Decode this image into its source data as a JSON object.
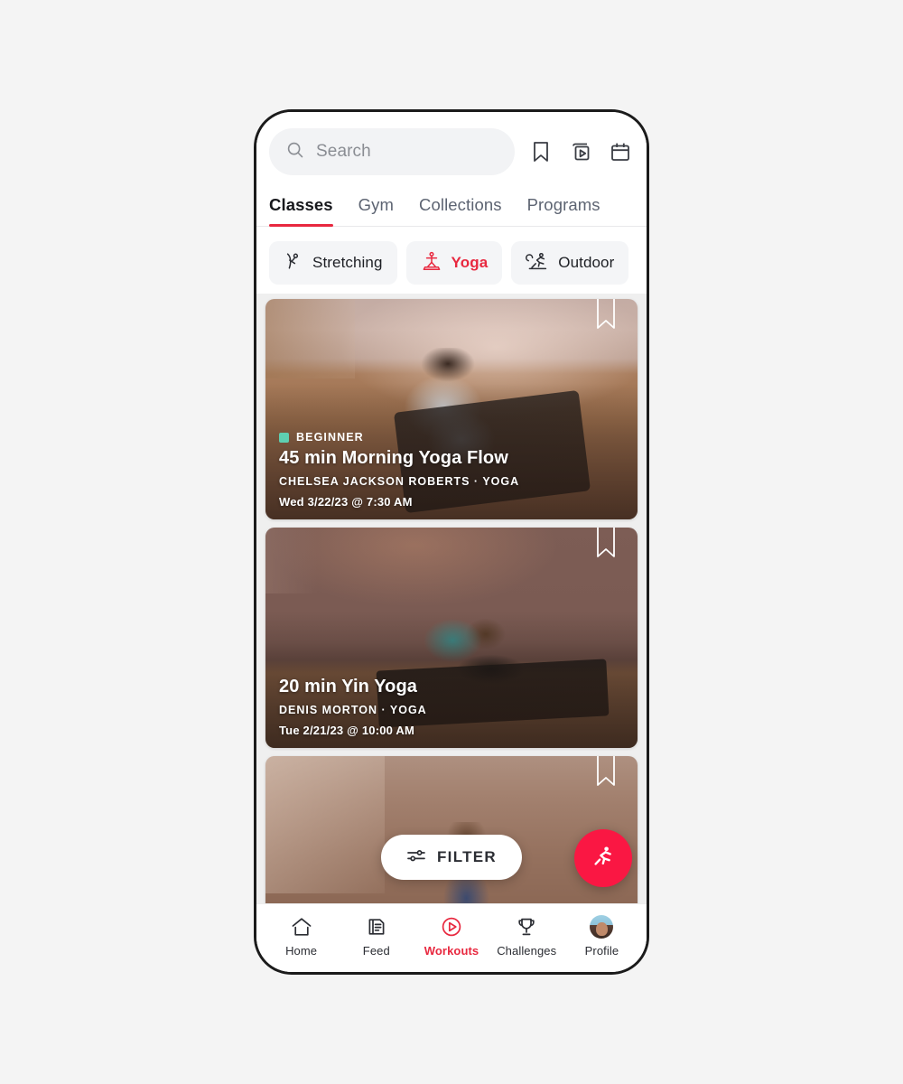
{
  "app": {
    "accent_red": "#e8283f",
    "fab_red": "#fa1743",
    "badge_teal": "#5ecfb1"
  },
  "search": {
    "placeholder": "Search",
    "value": "",
    "icon": "search-icon"
  },
  "header_icons": [
    {
      "name": "bookmark-icon",
      "label": "Saved"
    },
    {
      "name": "video-stack-icon",
      "label": "Videos"
    },
    {
      "name": "calendar-icon",
      "label": "Schedule"
    }
  ],
  "tabs": [
    {
      "label": "Classes",
      "active": true
    },
    {
      "label": "Gym",
      "active": false
    },
    {
      "label": "Collections",
      "active": false
    },
    {
      "label": "Programs",
      "active": false
    }
  ],
  "chips": [
    {
      "label": "Stretching",
      "icon": "stretching-figure-icon",
      "selected": false
    },
    {
      "label": "Yoga",
      "icon": "yoga-figure-icon",
      "selected": true
    },
    {
      "label": "Outdoor",
      "icon": "running-figure-icon",
      "selected": false
    }
  ],
  "cards": [
    {
      "badge": "BEGINNER",
      "has_badge": true,
      "title": "45 min Morning Yoga Flow",
      "subtitle": "CHELSEA JACKSON ROBERTS  ·  YOGA",
      "time": "Wed 3/22/23 @ 7:30 AM",
      "bookmark": "bookmark-ribbon-icon"
    },
    {
      "badge": "",
      "has_badge": false,
      "title": "20 min Yin Yoga",
      "subtitle": "DENIS MORTON  ·  YOGA",
      "time": "Tue 2/21/23 @ 10:00 AM",
      "bookmark": "bookmark-ribbon-icon"
    },
    {
      "badge": "",
      "has_badge": false,
      "title": "",
      "subtitle": "",
      "time": "",
      "bookmark": "bookmark-ribbon-icon"
    }
  ],
  "filter": {
    "label": "FILTER",
    "icon": "sliders-icon"
  },
  "fab": {
    "icon": "running-figure-icon",
    "label": "Start workout"
  },
  "bottom_nav": [
    {
      "label": "Home",
      "icon": "home-icon",
      "active": false
    },
    {
      "label": "Feed",
      "icon": "feed-icon",
      "active": false
    },
    {
      "label": "Workouts",
      "icon": "play-circle-icon",
      "active": true
    },
    {
      "label": "Challenges",
      "icon": "trophy-icon",
      "active": false
    },
    {
      "label": "Profile",
      "icon": "avatar-icon",
      "active": false
    }
  ]
}
